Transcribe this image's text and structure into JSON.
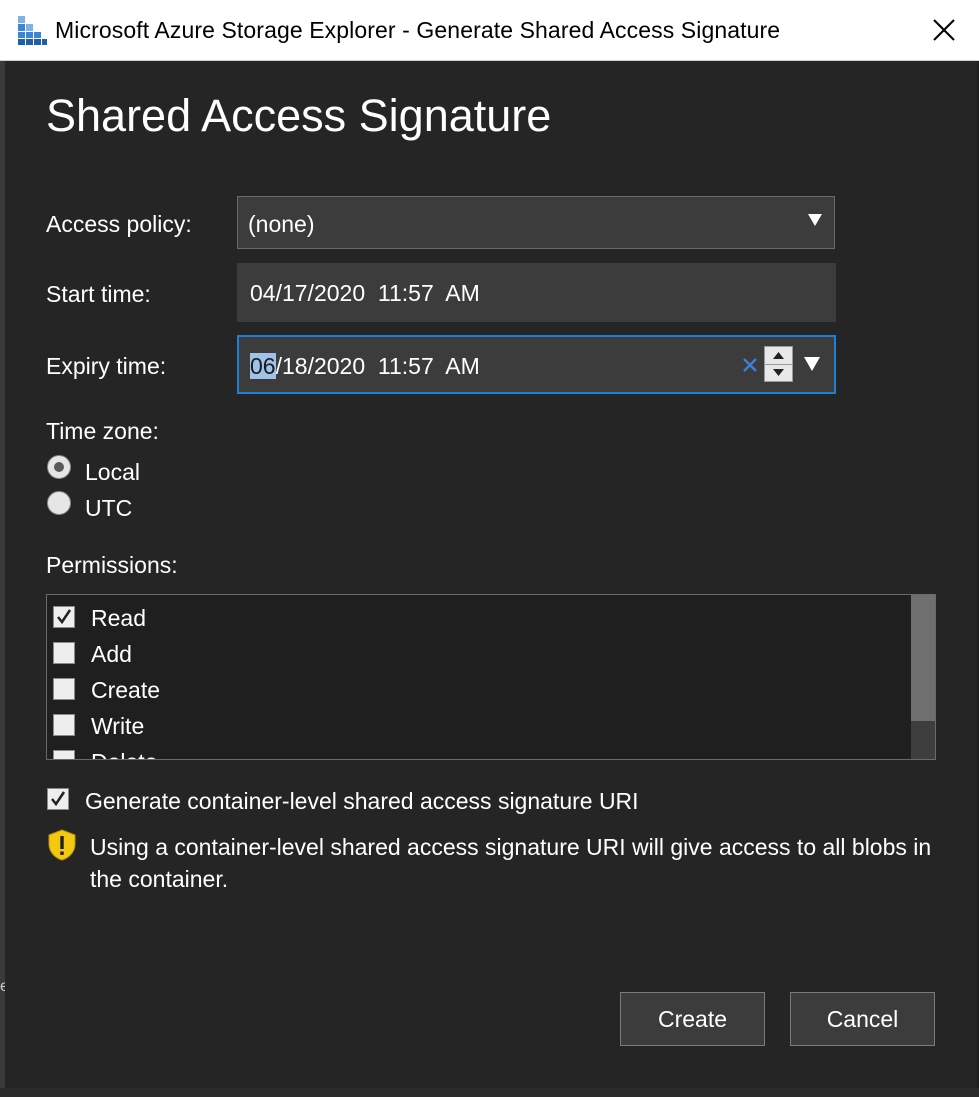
{
  "window": {
    "title": "Microsoft Azure Storage Explorer - Generate Shared Access Signature",
    "icon": "storage-explorer-icon",
    "close_icon": "close-icon"
  },
  "dialog": {
    "heading": "Shared Access Signature",
    "access_policy": {
      "label": "Access policy:",
      "value": "(none)"
    },
    "start_time": {
      "label": "Start time:",
      "value": "04/17/2020  11:57  AM"
    },
    "expiry_time": {
      "label": "Expiry time:",
      "selected_segment": "06",
      "value_rest": "/18/2020  11:57  AM"
    },
    "time_zone": {
      "label": "Time zone:",
      "options": [
        {
          "label": "Local",
          "selected": true
        },
        {
          "label": "UTC",
          "selected": false
        }
      ]
    },
    "permissions": {
      "label": "Permissions:",
      "items": [
        {
          "label": "Read",
          "checked": true
        },
        {
          "label": "Add",
          "checked": false
        },
        {
          "label": "Create",
          "checked": false
        },
        {
          "label": "Write",
          "checked": false
        },
        {
          "label": "Delete",
          "checked": false
        }
      ]
    },
    "container_level": {
      "label": "Generate container-level shared access signature URI",
      "checked": true
    },
    "warning": {
      "icon": "warning-shield-icon",
      "text": "Using a container-level shared access signature URI will give access to all blobs in the container."
    },
    "buttons": {
      "create": "Create",
      "cancel": "Cancel"
    }
  },
  "background_glyph": "e",
  "colors": {
    "dialog_bg": "#252526",
    "field_bg": "#3c3c3c",
    "focus_border": "#1f7fd4",
    "selection": "#9fc3e8",
    "warning_yellow": "#f2c811"
  }
}
